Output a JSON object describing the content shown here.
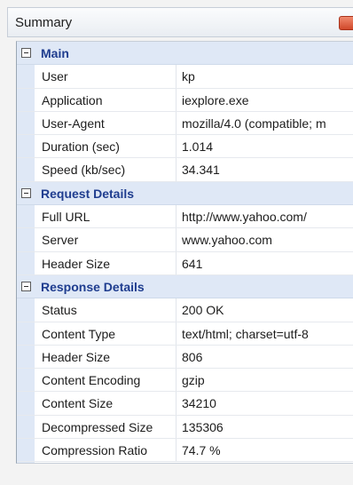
{
  "window": {
    "title": "Summary"
  },
  "sections": [
    {
      "title": "Main",
      "rows": [
        {
          "name": "User",
          "value": "kp"
        },
        {
          "name": "Application",
          "value": "iexplore.exe"
        },
        {
          "name": "User-Agent",
          "value": "mozilla/4.0 (compatible; m"
        },
        {
          "name": "Duration (sec)",
          "value": "1.014"
        },
        {
          "name": "Speed (kb/sec)",
          "value": "34.341"
        }
      ]
    },
    {
      "title": "Request Details",
      "rows": [
        {
          "name": "Full URL",
          "value": "http://www.yahoo.com/"
        },
        {
          "name": "Server",
          "value": "www.yahoo.com"
        },
        {
          "name": "Header Size",
          "value": "641"
        }
      ]
    },
    {
      "title": "Response Details",
      "rows": [
        {
          "name": "Status",
          "value": "200 OK"
        },
        {
          "name": "Content Type",
          "value": "text/html; charset=utf-8"
        },
        {
          "name": "Header Size",
          "value": "806"
        },
        {
          "name": "Content Encoding",
          "value": "gzip"
        },
        {
          "name": "Content Size",
          "value": "34210"
        },
        {
          "name": "Decompressed Size",
          "value": "135306"
        },
        {
          "name": "Compression Ratio",
          "value": "74.7 %"
        }
      ]
    }
  ]
}
